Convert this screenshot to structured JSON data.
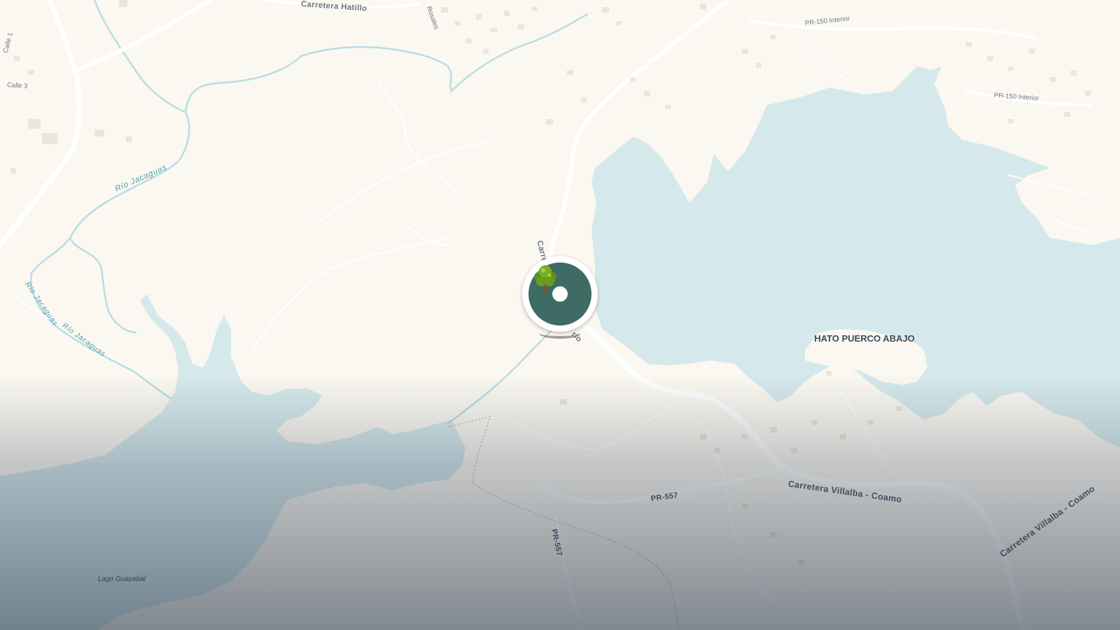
{
  "map": {
    "road_labels": {
      "carretera_hatillo": "Carretera Hatillo",
      "pr150_interior_top": "PR-150 Interior",
      "pr150_interior_right": "PR-150 Interior",
      "calle_1": "Calle 1",
      "calle_3": "Calle 3",
      "rosales": "Rosales",
      "carretera_partial": "Carret",
      "rio_partial": "rio",
      "villalba_coamo": "Carretera Villalba - Coamo",
      "villalba_coamo_2": "Carretera Villalba - Coamo",
      "pr557_a": "PR-557",
      "pr557_b": "PR-557"
    },
    "water_labels": {
      "rio_jacaguas_1": "Río Jacaguas",
      "rio_jacaguas_2": "Río Jacaguas",
      "rio_jacaguas_3": "Río Jacaguas",
      "lago": "Lago Guayabal"
    },
    "place_labels": {
      "hato_puerco_abajo": "HATO PUERCO ABAJO"
    },
    "marker": {
      "icon": "tree-icon",
      "color": "#3e6b63"
    },
    "colors": {
      "land": "#fbf8f1",
      "water": "#d5e9ec",
      "road": "#ffffff",
      "river": "#b8dde4"
    }
  }
}
